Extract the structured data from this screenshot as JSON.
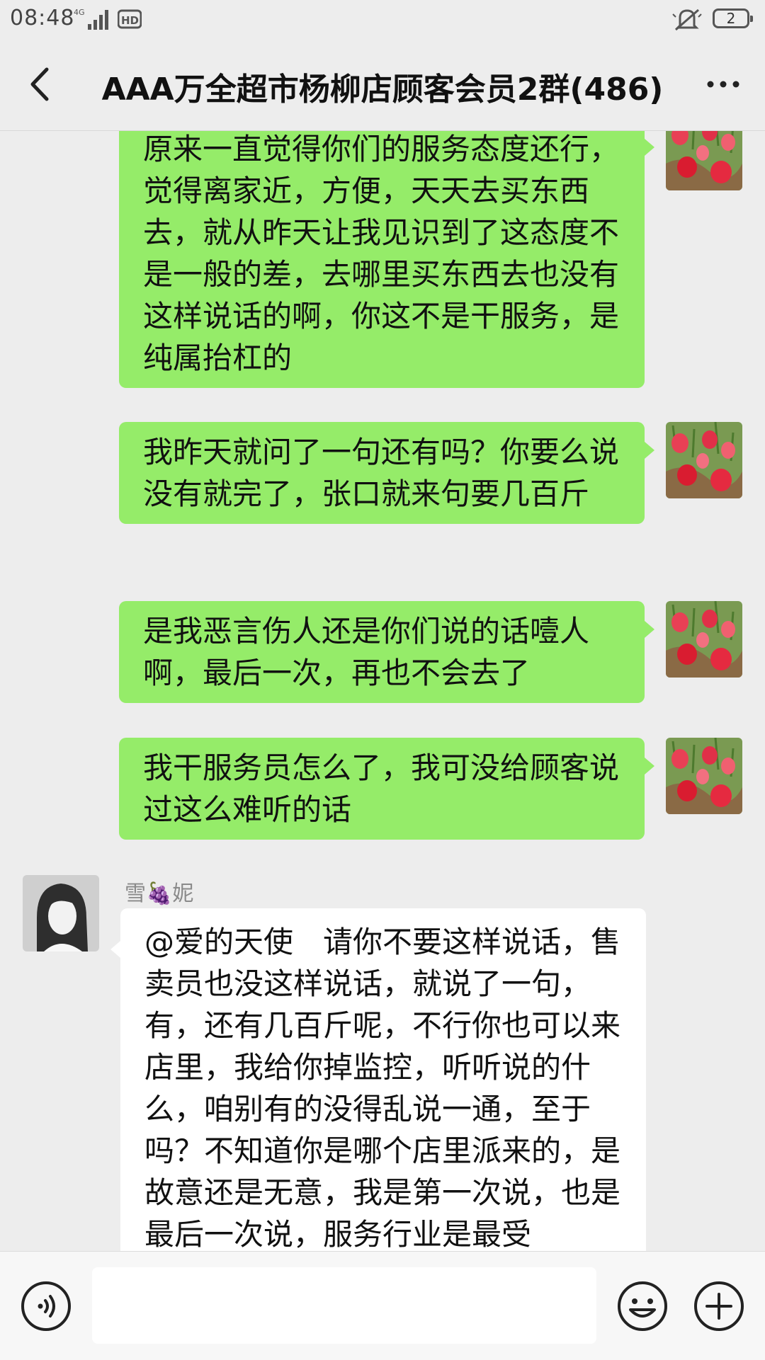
{
  "status_bar": {
    "time": "08:48",
    "network": "4G",
    "hd_badge": "HD",
    "battery_level": "2"
  },
  "header": {
    "title": "AAA万全超市杨柳店顾客会员2群(486)"
  },
  "messages": [
    {
      "side": "right",
      "text": "原来一直觉得你们的服务态度还行，觉得离家近，方便，天天去买东西去，就从昨天让我见识到了这态度不是一般的差，去哪里买东西去也没有这样说话的啊，你这不是干服务，是纯属抬杠的"
    },
    {
      "side": "right",
      "text": "我昨天就问了一句还有吗？你要么说没有就完了，张口就来句要几百斤"
    },
    {
      "side": "right",
      "text": "是我恶言伤人还是你们说的话噎人啊，最后一次，再也不会去了"
    },
    {
      "side": "right",
      "text": "我干服务员怎么了，我可没给顾客说过这么难听的话"
    },
    {
      "side": "left",
      "sender": "雪🍇妮",
      "text": "@爱的天使　请你不要这样说话，售卖员也没这样说话，就说了一句，有，还有几百斤呢，不行你也可以来店里，我给你掉监控，听听说的什么，咱别有的没得乱说一通，至于吗？不知道你是哪个店里派来的，是故意还是无意，我是第一次说，也是最后一次说，服务行业是最受"
    }
  ],
  "input_bar": {
    "placeholder": ""
  },
  "colors": {
    "outgoing_bubble": "#95ec69",
    "incoming_bubble": "#ffffff",
    "background": "#ededed"
  },
  "icons": [
    "back-arrow-icon",
    "more-dots-icon",
    "voice-icon",
    "emoji-icon",
    "plus-icon",
    "mute-icon"
  ]
}
